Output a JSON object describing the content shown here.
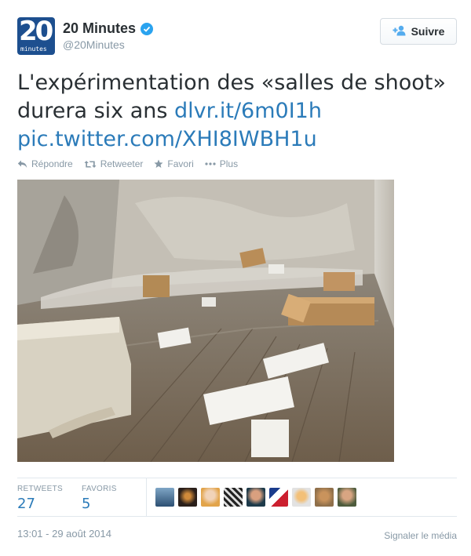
{
  "account": {
    "name": "20 Minutes",
    "handle": "@20Minutes",
    "avatar_number": "20",
    "avatar_text": "minutes"
  },
  "follow_button": {
    "label": "Suivre"
  },
  "tweet": {
    "text_main": "L'expérimentation des «salles de shoot» durera six ans ",
    "link1": "dlvr.it/6m0I1h",
    "link2": "pic.twitter.com/XHI8IWBH1u"
  },
  "actions": [
    {
      "label": "Répondre",
      "icon": "reply-icon"
    },
    {
      "label": "Retweeter",
      "icon": "retweet-icon"
    },
    {
      "label": "Favori",
      "icon": "star-icon"
    },
    {
      "label": "Plus",
      "icon": "more-icon"
    }
  ],
  "stats": {
    "retweets_label": "RETWEETS",
    "retweets_value": "27",
    "favorites_label": "FAVORIS",
    "favorites_value": "5"
  },
  "favoriter_avatars": [
    "favoriter-avatar-1",
    "favoriter-avatar-2",
    "favoriter-avatar-3",
    "favoriter-avatar-4",
    "favoriter-avatar-5",
    "favoriter-avatar-6",
    "favoriter-avatar-7",
    "favoriter-avatar-8",
    "favoriter-avatar-9"
  ],
  "footer": {
    "timestamp": "13:01 - 29 août 2014",
    "report_link": "Signaler le média"
  },
  "colors": {
    "link": "#2b7bb9",
    "muted": "#8899a6",
    "verified": "#2aa3ef",
    "avatar_bg": "#1d4f8f"
  }
}
